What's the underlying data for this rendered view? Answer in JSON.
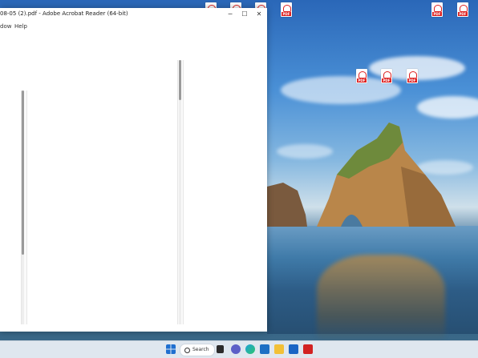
{
  "window": {
    "title": "08-05 (2).pdf - Adobe Acrobat Reader (64-bit)",
    "menu": [
      "dow",
      "Help"
    ],
    "controls": {
      "minimize": "─",
      "maximize": "☐",
      "close": "✕"
    }
  },
  "taskbar": {
    "search_label": "Search"
  },
  "colors": {
    "pdf_red": "#d22222",
    "taskbar_bg": "#dfe7ef",
    "window_bg": "#ffffff"
  }
}
